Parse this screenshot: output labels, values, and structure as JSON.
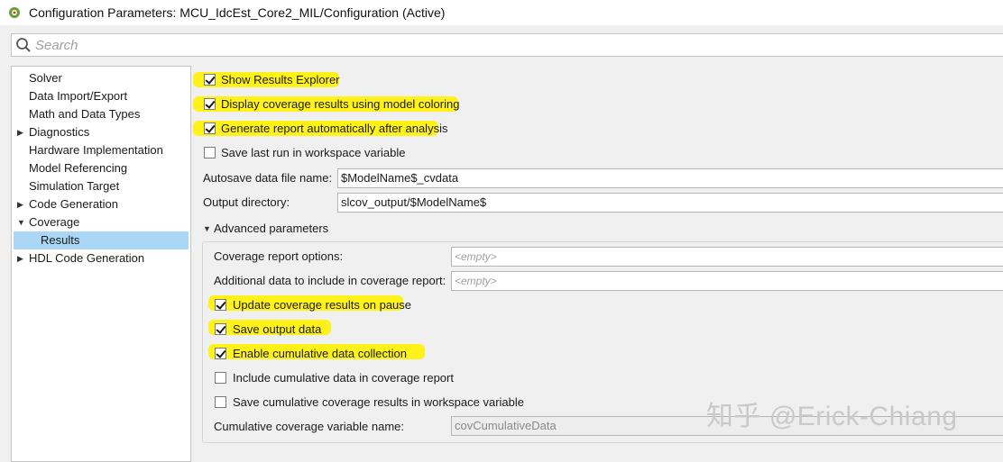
{
  "window": {
    "title": "Configuration Parameters: MCU_IdcEst_Core2_MIL/Configuration (Active)"
  },
  "search": {
    "placeholder": "Search"
  },
  "tree": {
    "items": [
      {
        "label": "Solver",
        "expandable": false,
        "selected": false
      },
      {
        "label": "Data Import/Export",
        "expandable": false,
        "selected": false
      },
      {
        "label": "Math and Data Types",
        "expandable": false,
        "selected": false
      },
      {
        "label": "Diagnostics",
        "expandable": true,
        "expanded": false,
        "selected": false
      },
      {
        "label": "Hardware Implementation",
        "expandable": false,
        "selected": false
      },
      {
        "label": "Model Referencing",
        "expandable": false,
        "selected": false
      },
      {
        "label": "Simulation Target",
        "expandable": false,
        "selected": false
      },
      {
        "label": "Code Generation",
        "expandable": true,
        "expanded": false,
        "selected": false
      },
      {
        "label": "Coverage",
        "expandable": true,
        "expanded": true,
        "selected": false
      },
      {
        "label": "Results",
        "expandable": false,
        "selected": true
      },
      {
        "label": "HDL Code Generation",
        "expandable": true,
        "expanded": false,
        "selected": false
      }
    ]
  },
  "results": {
    "show_results_explorer": {
      "label": "Show Results Explorer",
      "checked": true
    },
    "display_coverage_coloring": {
      "label": "Display coverage results using model coloring",
      "checked": true
    },
    "generate_report": {
      "label": "Generate report automatically after analysis",
      "checked": true
    },
    "save_last_run": {
      "label": "Save last run in workspace variable",
      "checked": false
    },
    "autosave_file": {
      "label": "Autosave data file name:",
      "value": "$ModelName$_cvdata"
    },
    "output_directory": {
      "label": "Output directory:",
      "value": "slcov_output/$ModelName$"
    },
    "advanced": {
      "header": "Advanced parameters",
      "report_options": {
        "label": "Coverage report options:",
        "value": "<empty>"
      },
      "additional_data": {
        "label": "Additional data to include in coverage report:",
        "value": "<empty>"
      },
      "update_on_pause": {
        "label": "Update coverage results on pause",
        "checked": true
      },
      "save_output_data": {
        "label": "Save output data",
        "checked": true
      },
      "cumulative_collection": {
        "label": "Enable cumulative data collection",
        "checked": true
      },
      "include_cumulative": {
        "label": "Include cumulative data in coverage report",
        "checked": false
      },
      "save_cumulative": {
        "label": "Save cumulative coverage results in workspace variable",
        "checked": false
      },
      "cumulative_var": {
        "label": "Cumulative coverage variable name:",
        "value": "covCumulativeData"
      }
    }
  },
  "watermark": "知乎 @Erick-Chiang",
  "colors": {
    "highlight": "#fff200",
    "selection": "#a9d7f5"
  }
}
